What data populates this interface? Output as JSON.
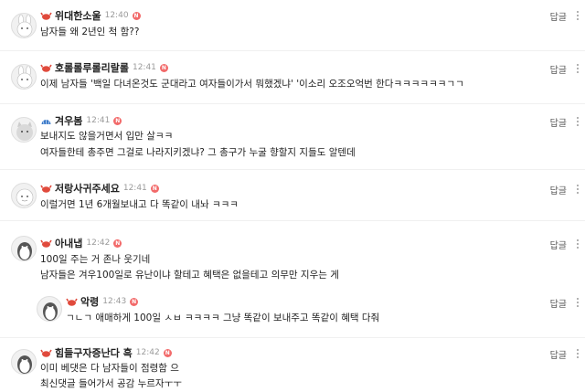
{
  "reply_label": "답글",
  "new_badge": "N",
  "comments": [
    {
      "nick": "위대한소울",
      "time": "12:40",
      "lines": [
        "남자들 왜 2년인 척 함??"
      ],
      "grade_icon": "crab-icon",
      "avatar": "rabbit-avatar"
    },
    {
      "nick": "호롤롤루롤리랄롤",
      "time": "12:41",
      "lines": [
        "이제 남자들 '백일 다녀온것도 군대라고 여자들이가서 뭐했겠냐' '이소리 오조오억번 한다ㅋㅋㅋㅋㅋㅋㄱㄱ"
      ],
      "grade_icon": "crab-icon",
      "avatar": "rabbit-avatar"
    },
    {
      "nick": "겨우봄",
      "time": "12:41",
      "lines": [
        "보내지도 않을거면서 입만 살ㅋㅋ",
        "여자들한테 총주면 그걸로 나라지키겠냐? 그 총구가 누굴 향할지 지들도 알텐데"
      ],
      "grade_icon": "shell-icon",
      "avatar": "cat-avatar"
    },
    {
      "nick": "저랑사귀주세요",
      "time": "12:41",
      "lines": [
        "이럴거면 1년 6개월보내고 다 똑같이 내놔 ㅋㅋㅋ"
      ],
      "grade_icon": "crab-icon",
      "avatar": "seal-avatar"
    },
    {
      "nick": "아내냅",
      "time": "12:42",
      "lines": [
        "100일 주는 거 존나 웃기네",
        "남자들은 겨우100일로 유난이냐 할테고 혜택은 없을테고 의무만 지우는 게"
      ],
      "grade_icon": "crab-icon",
      "avatar": "penguin-avatar"
    },
    {
      "nick": "악령",
      "time": "12:43",
      "lines": [
        "ㄱㄴㄱ 애매하게 100일 ㅅㅂ ㅋㅋㅋㅋ 그냥 똑같이 보내주고 똑같이 혜택 다줘"
      ],
      "grade_icon": "crab-icon",
      "avatar": "penguin-avatar",
      "is_reply": true
    },
    {
      "nick": "힘들구자증난다 흑",
      "time": "12:42",
      "lines": [
        "이미 베댓은 다 남자들이 점령함 으",
        "최신댓글 들어가서 공감 누르자ㅜㅜ"
      ],
      "grade_icon": "crab-icon",
      "avatar": "penguin-avatar"
    }
  ],
  "colors": {
    "crab": "#e04a3c",
    "shell": "#3a79c9",
    "badge": "#f26a6a"
  }
}
